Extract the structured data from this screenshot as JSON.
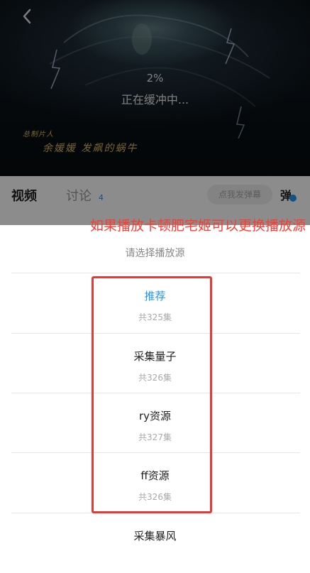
{
  "player": {
    "buffer_percent": "2%",
    "buffer_text": "正在缓冲中...",
    "credit_small": "总制片人",
    "credit_names": "余媛媛  发飙的蜗牛"
  },
  "tabs": {
    "video": "视频",
    "discuss": "讨论",
    "discuss_count": "4",
    "danmaku_placeholder": "点我发弹幕",
    "danmaku_toggle": "弹"
  },
  "annotation": "如果播放卡顿肥宅姬可以更换播放源",
  "sheet": {
    "title": "请选择播放源",
    "sources": [
      {
        "name": "推荐",
        "count": "共325集"
      },
      {
        "name": "采集量子",
        "count": "共326集"
      },
      {
        "name": "ry资源",
        "count": "共327集"
      },
      {
        "name": "ff资源",
        "count": "共326集"
      },
      {
        "name": "采集暴风",
        "count": ""
      }
    ]
  },
  "colors": {
    "accent": "#2196f3",
    "annotation": "#ff3b30",
    "highlight_box": "#e53935",
    "credit_gold": "#d9b85a"
  }
}
